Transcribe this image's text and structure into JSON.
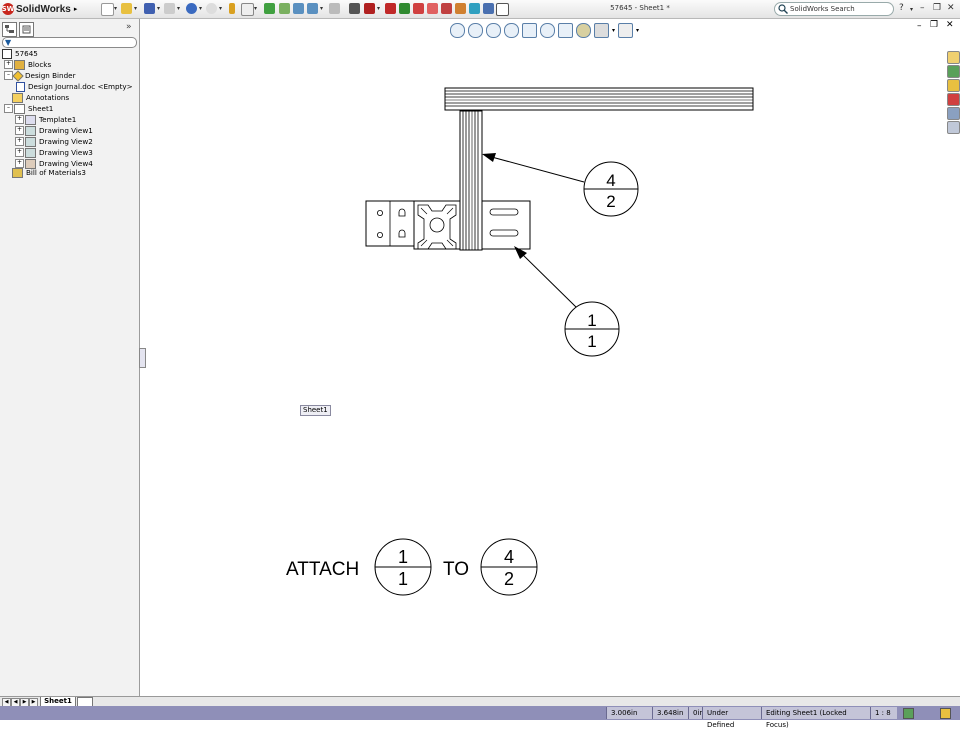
{
  "app": {
    "name": "SolidWorks",
    "document_title": "57645 - Sheet1 *"
  },
  "search": {
    "placeholder": "SolidWorks Search"
  },
  "feature_tree": {
    "items": [
      {
        "label": "57645"
      },
      {
        "label": "Blocks"
      },
      {
        "label": "Design Binder"
      },
      {
        "label": "Design Journal.doc <Empty>"
      },
      {
        "label": "Annotations"
      },
      {
        "label": "Sheet1"
      },
      {
        "label": "Template1"
      },
      {
        "label": "Drawing View1"
      },
      {
        "label": "Drawing View2"
      },
      {
        "label": "Drawing View3"
      },
      {
        "label": "Drawing View4"
      },
      {
        "label": "Bill of Materials3"
      }
    ]
  },
  "drawing": {
    "balloon_top": {
      "upper": "4",
      "lower": "2"
    },
    "balloon_bottom": {
      "upper": "1",
      "lower": "1"
    },
    "instruction": {
      "attach": "ATTACH",
      "to": "TO",
      "from_balloon": {
        "upper": "1",
        "lower": "1"
      },
      "to_balloon": {
        "upper": "4",
        "lower": "2"
      }
    },
    "sheet_label": "Sheet1"
  },
  "sheet_tabs": {
    "active": "Sheet1"
  },
  "status_bar": {
    "x_coord": "3.006in",
    "y_coord": "3.648in",
    "z_coord": "0in",
    "definition_state": "Under Defined",
    "editing": "Editing Sheet1 (Locked Focus)",
    "scale": "1 : 8"
  }
}
